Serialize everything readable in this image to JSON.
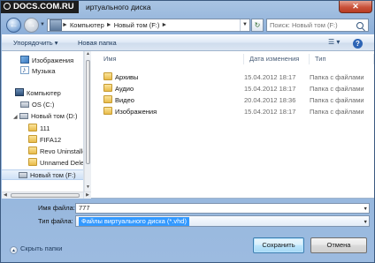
{
  "watermark": "DOCS.COM.RU",
  "window": {
    "title": "иртуального диска",
    "close_label": "✕"
  },
  "nav": {
    "back_icon": "←",
    "forward_icon": "→",
    "breadcrumb": [
      "Компьютер",
      "Новый том (F:)"
    ],
    "separator": "►",
    "search_placeholder": "Поиск: Новый том (F:)"
  },
  "toolbar": {
    "organize_label": "Упорядочить ▾",
    "new_folder_label": "Новая папка",
    "help_label": "?"
  },
  "sidebar": {
    "items": [
      {
        "label": "Изображения",
        "icon": "pictures-icon"
      },
      {
        "label": "Музыка",
        "icon": "music-icon"
      },
      {
        "label": "Компьютер",
        "icon": "computer-icon"
      },
      {
        "label": "OS (C:)",
        "icon": "drive-icon"
      },
      {
        "label": "Новый том (D:)",
        "icon": "drive-icon"
      },
      {
        "label": "111",
        "icon": "folder-icon"
      },
      {
        "label": "FIFA12",
        "icon": "folder-icon"
      },
      {
        "label": "Revo Uninstalle",
        "icon": "folder-icon"
      },
      {
        "label": "Unnamed Dele",
        "icon": "folder-icon"
      },
      {
        "label": "Новый том (F:)",
        "icon": "drive-icon"
      }
    ]
  },
  "filelist": {
    "columns": [
      "Имя",
      "Дата изменения",
      "Тип"
    ],
    "rows": [
      {
        "name": "Архивы",
        "date": "15.04.2012 18:17",
        "type": "Папка с файлами"
      },
      {
        "name": "Аудио",
        "date": "15.04.2012 18:17",
        "type": "Папка с файлами"
      },
      {
        "name": "Видео",
        "date": "20.04.2012 18:36",
        "type": "Папка с файлами"
      },
      {
        "name": "Изображения",
        "date": "15.04.2012 18:17",
        "type": "Папка с файлами"
      }
    ]
  },
  "form": {
    "filename_label": "Имя файла:",
    "filename_value": "777",
    "filetype_label": "Тип файла:",
    "filetype_value": "Файлы виртуального диска (*.vhd)"
  },
  "footer": {
    "hide_folders_label": "Скрыть папки",
    "save_label": "Сохранить",
    "cancel_label": "Отмена"
  }
}
